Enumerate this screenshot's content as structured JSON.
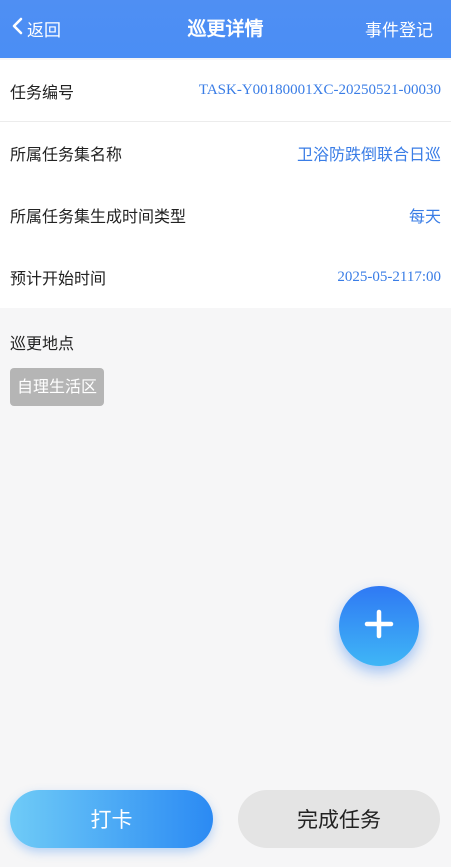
{
  "header": {
    "back_label": "返回",
    "title": "巡更详情",
    "register_label": "事件登记"
  },
  "info_rows": [
    {
      "label": "任务编号",
      "value": "TASK-Y00180001XC-20250521-00030"
    },
    {
      "label": "所属任务集名称",
      "value": "卫浴防跌倒联合日巡"
    },
    {
      "label": "所属任务集生成时间类型",
      "value": "每天"
    },
    {
      "label": "预计开始时间",
      "value": "2025-05-2117:00"
    }
  ],
  "location": {
    "title": "巡更地点",
    "tags": [
      "自理生活区"
    ]
  },
  "fab": {
    "icon": "plus-icon"
  },
  "actions": {
    "checkin_label": "打卡",
    "complete_label": "完成任务"
  },
  "colors": {
    "header_blue": "#4a8ef5",
    "value_blue": "#3a7de6",
    "tag_gray": "#b5b5b5",
    "page_bg": "#f6f6f7"
  }
}
